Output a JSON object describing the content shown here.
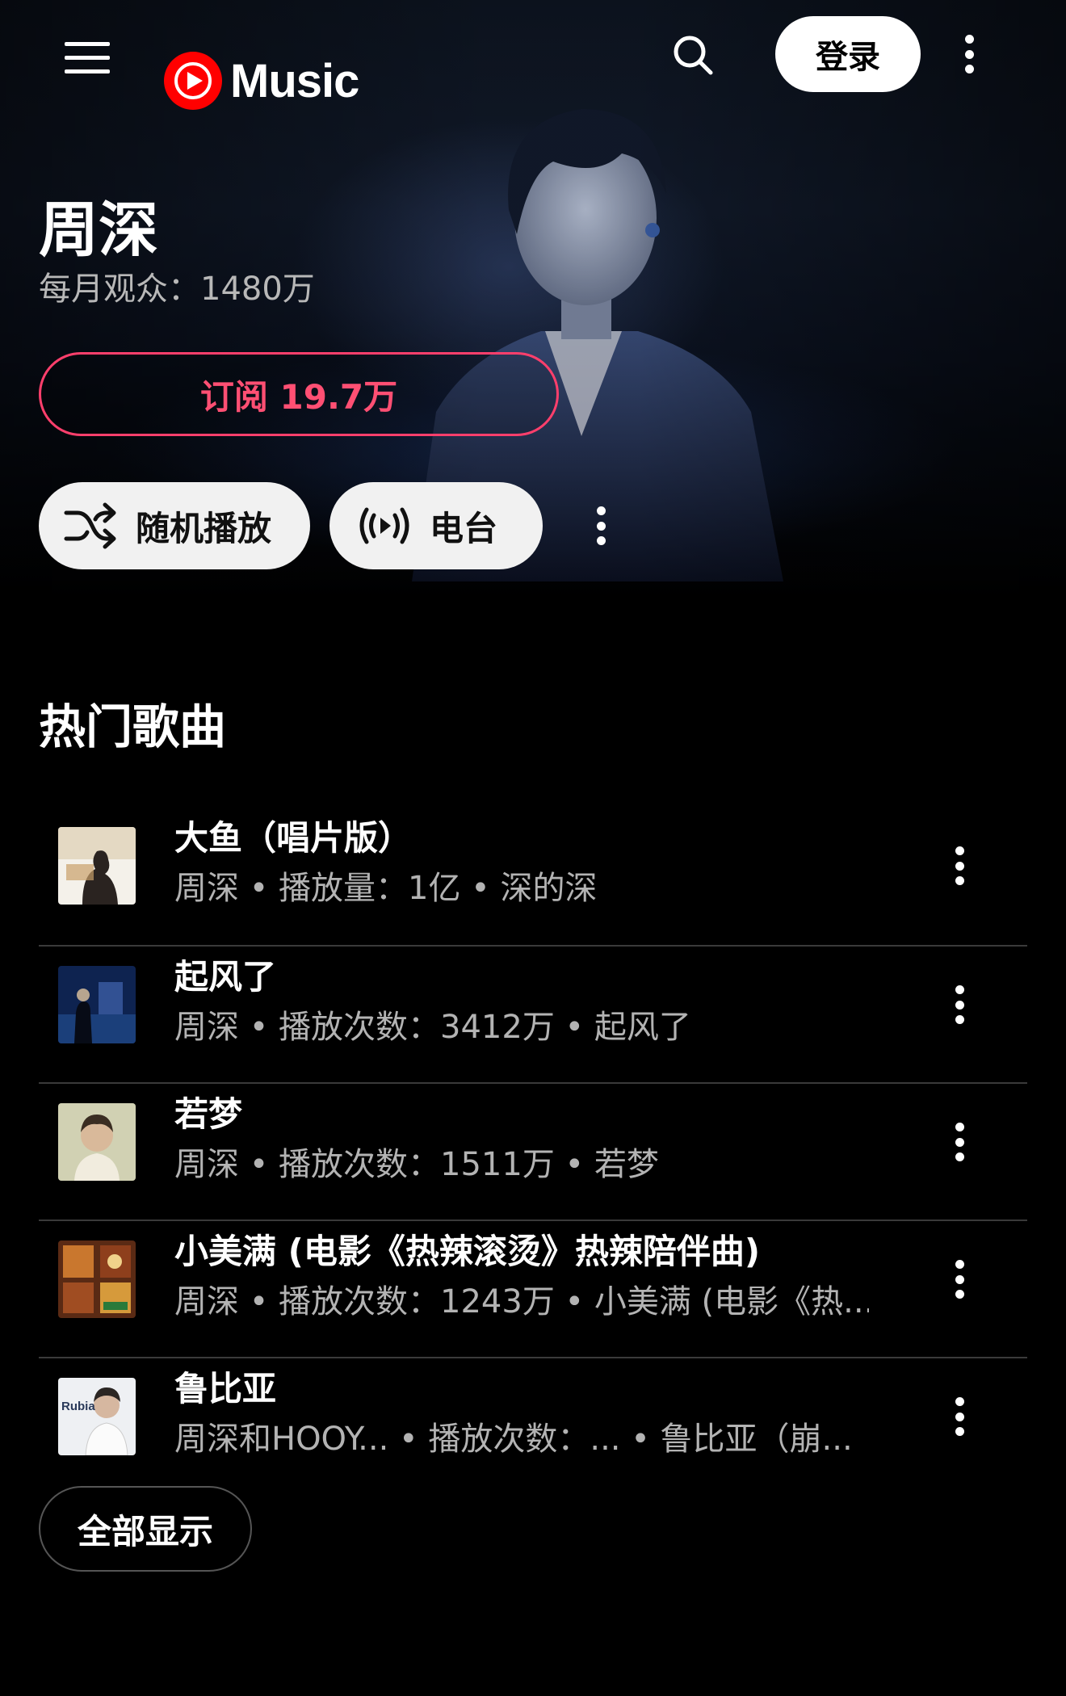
{
  "app": {
    "logo_text": "Music",
    "brand_color": "#ff0000",
    "accent_color": "#ff3f6c"
  },
  "header": {
    "menu_icon": "hamburger-menu-icon",
    "search_icon": "search-icon",
    "login_label": "登录",
    "more_icon": "more-vert-icon"
  },
  "artist": {
    "name": "周深",
    "monthly_audience": "每月观众：1480万",
    "subscribe_label": "订阅 19.7万"
  },
  "actions": {
    "shuffle_label": "随机播放",
    "shuffle_icon": "shuffle-icon",
    "radio_label": "电台",
    "radio_icon": "radio-broadcast-icon",
    "more_icon": "more-vert-icon"
  },
  "top_songs": {
    "title": "热门歌曲",
    "songs": [
      {
        "title": "大鱼（唱片版）",
        "meta": "周深 • 播放量：1亿 • 深的深"
      },
      {
        "title": "起风了",
        "meta": "周深 • 播放次数：3412万 • 起风了"
      },
      {
        "title": "若梦",
        "meta": "周深 • 播放次数：1511万 • 若梦"
      },
      {
        "title": "小美满 (电影《热辣滚烫》热辣陪伴曲)",
        "meta": "周深 • 播放次数：1243万 • 小美满 (电影《热..."
      },
      {
        "title": "鲁比亚",
        "meta": "周深和HOOY... • 播放次数：... • 鲁比亚（崩...",
        "thumb_text": "Rubia"
      }
    ],
    "show_all_label": "全部显示"
  }
}
